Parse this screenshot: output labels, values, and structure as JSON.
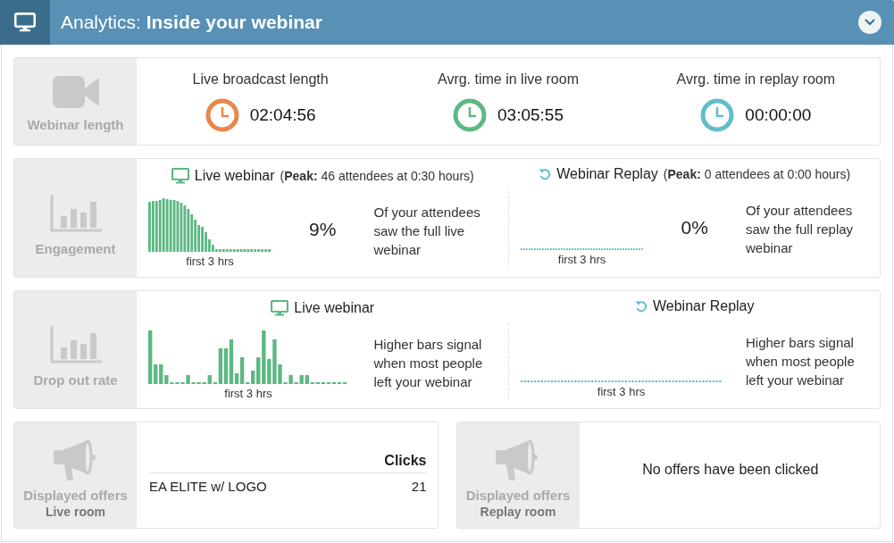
{
  "header": {
    "title": "Analytics: **Inside your webinar**"
  },
  "webinar_length": {
    "label": "Webinar length",
    "stats": [
      {
        "label": "Live broadcast length",
        "value": "02:04:56",
        "color": "#e8874a"
      },
      {
        "label": "Avrg. time in live room",
        "value": "03:05:55",
        "color": "#5cb882"
      },
      {
        "label": "Avrg. time in replay room",
        "value": "00:00:00",
        "color": "#62bccb"
      }
    ]
  },
  "engagement": {
    "label": "Engagement",
    "panels": [
      {
        "kind": "live",
        "title": "Live webinar",
        "peak": "(**Peak:** 46 attendees at 0:30 hours)",
        "axis_label": "first 3 hrs",
        "percent": "9%",
        "description": "Of your attendees saw the full live webinar"
      },
      {
        "kind": "replay",
        "title": "Webinar Replay",
        "peak": "(**Peak:** 0 attendees at 0:00 hours)",
        "axis_label": "first 3 hrs",
        "percent": "0%",
        "description": "Of your attendees saw the full replay webinar"
      }
    ]
  },
  "drop_out": {
    "label": "Drop out rate",
    "panels": [
      {
        "kind": "live",
        "title": "Live webinar",
        "axis_label": "first 3 hrs",
        "description": "Higher bars signal when most people left your webinar"
      },
      {
        "kind": "replay",
        "title": "Webinar Replay",
        "axis_label": "first 3 hrs",
        "description": "Higher bars signal when most people left your webinar"
      }
    ]
  },
  "offers": [
    {
      "label": "Displayed offers",
      "room": "Live room",
      "table": {
        "header": "Clicks",
        "rows": [
          {
            "name": "EA ELITE w/ LOGO",
            "clicks": "21"
          }
        ]
      }
    },
    {
      "label": "Displayed offers",
      "room": "Replay room",
      "message": "No offers have been clicked"
    }
  ]
}
